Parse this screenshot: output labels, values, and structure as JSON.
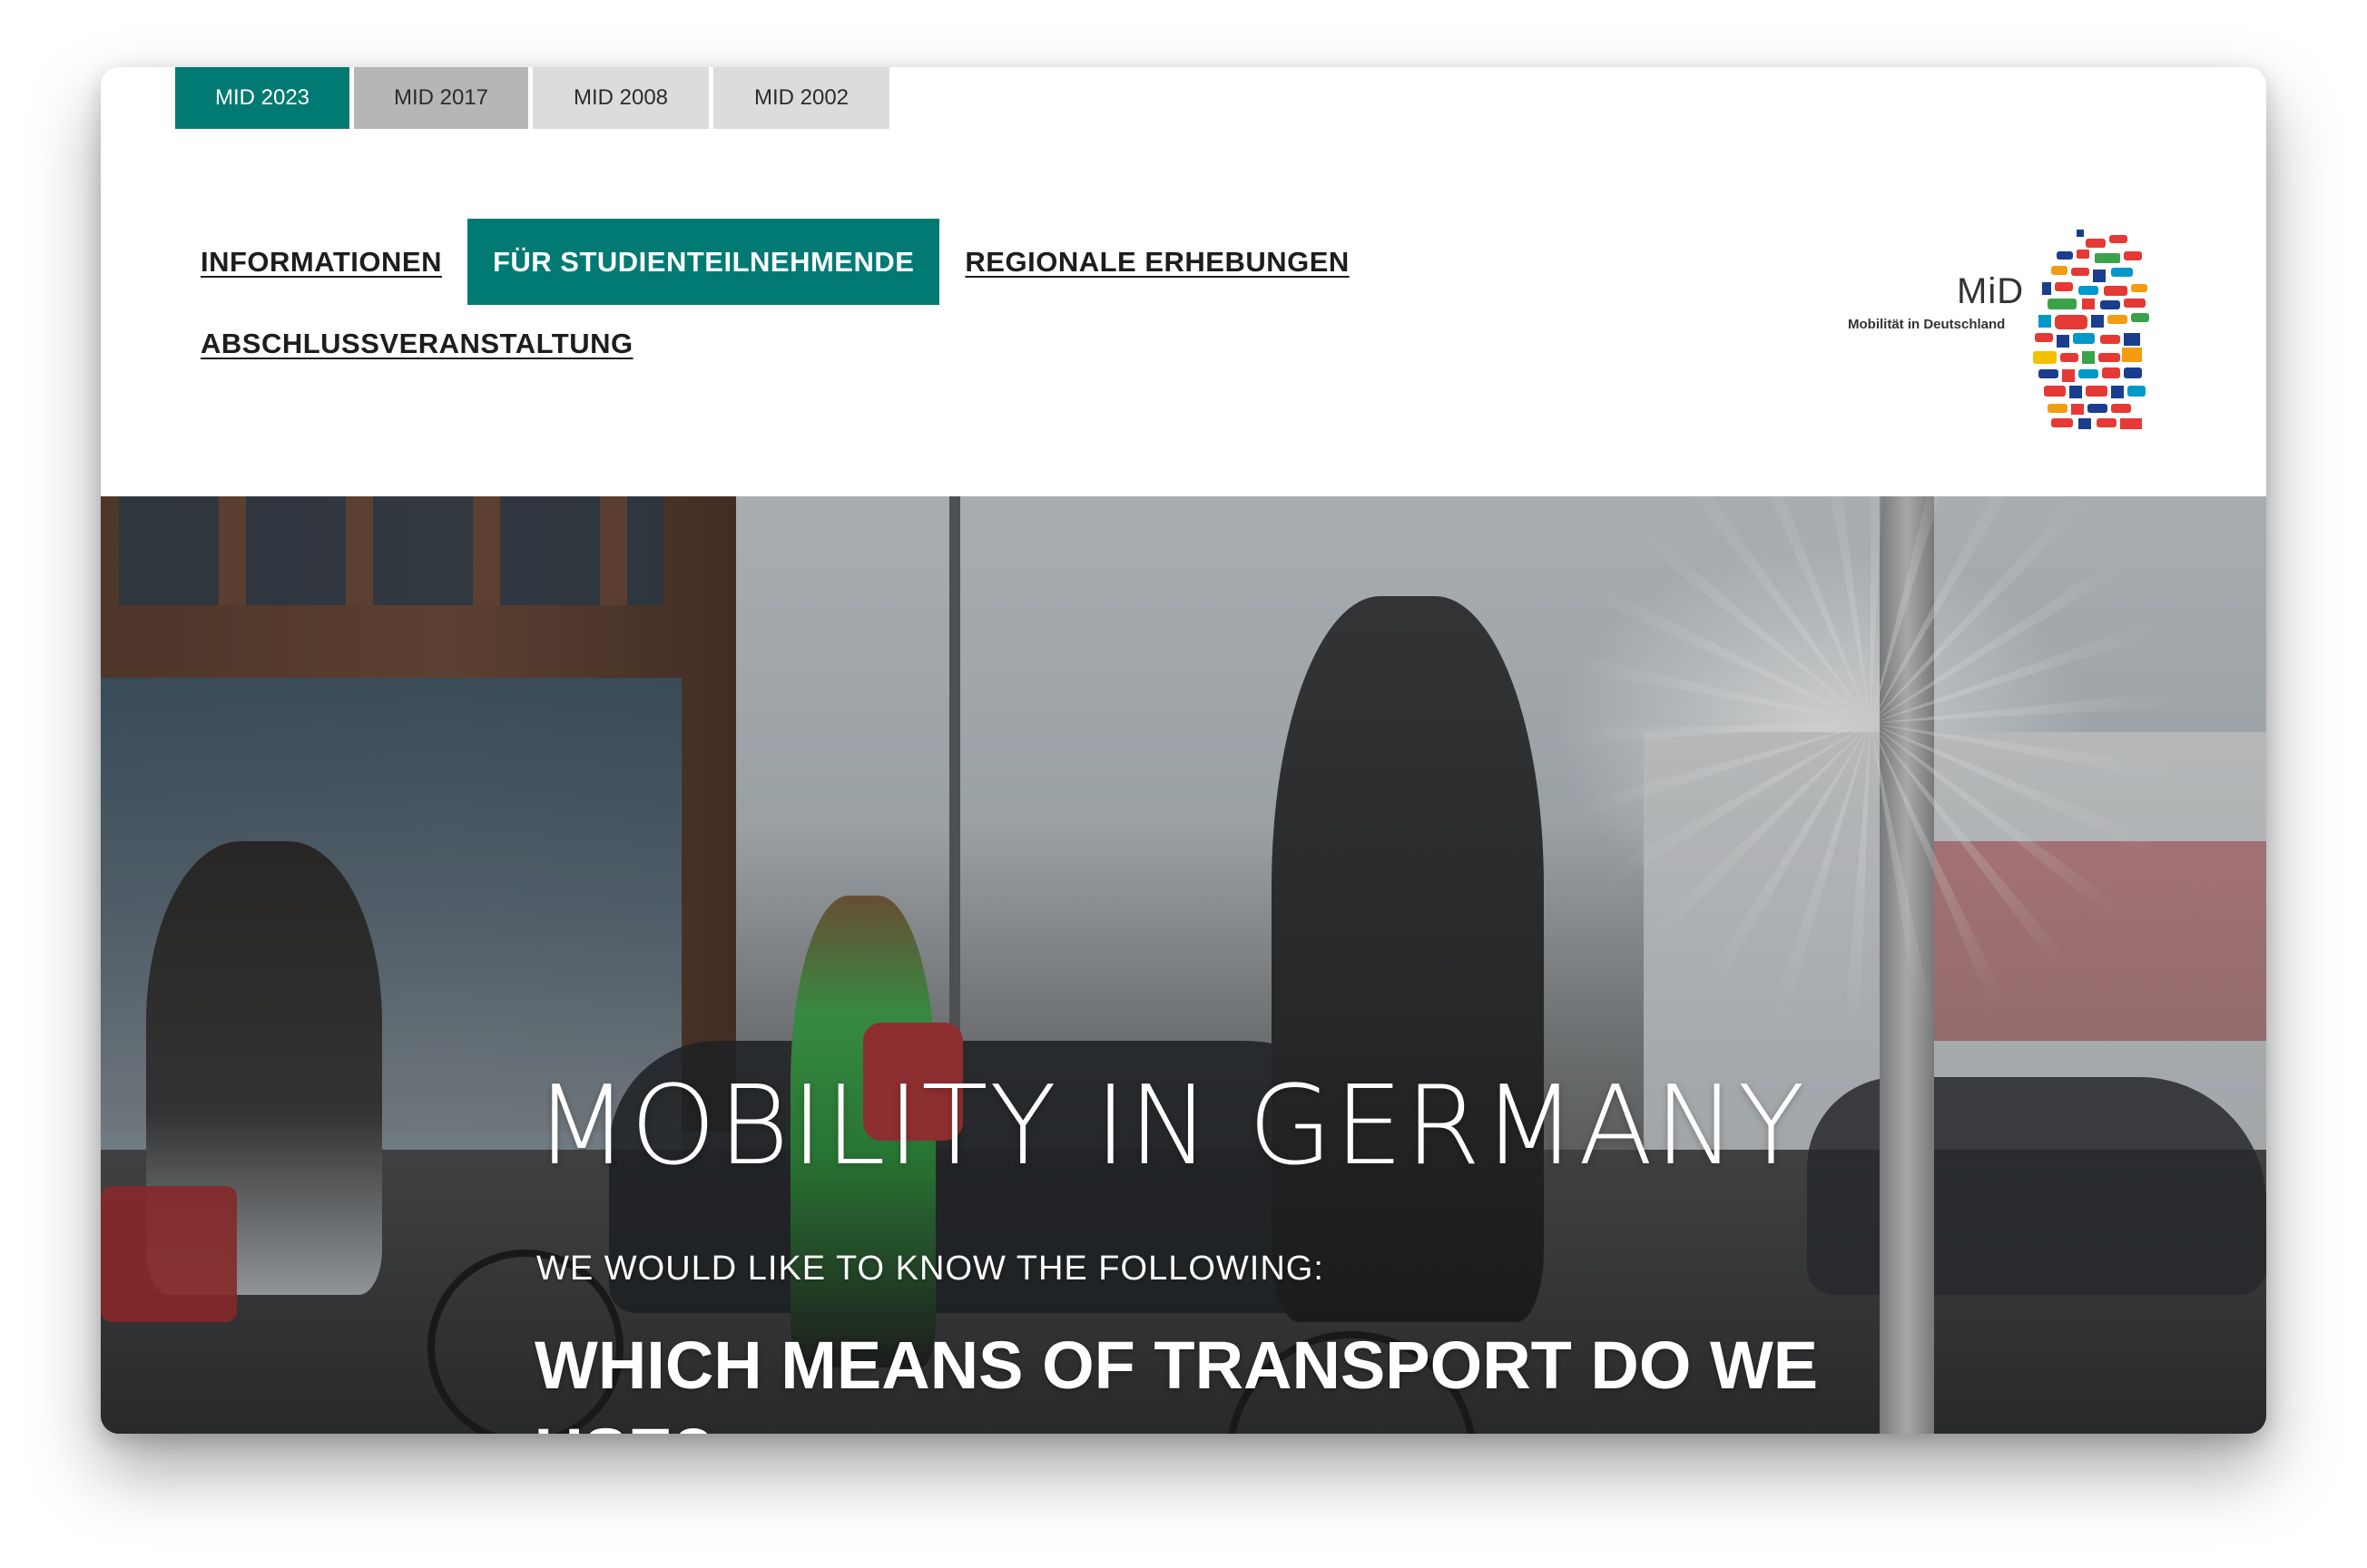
{
  "version_tabs": [
    {
      "label": "MID 2023",
      "state": "active"
    },
    {
      "label": "MID 2017",
      "state": "hover"
    },
    {
      "label": "MID 2008",
      "state": "default"
    },
    {
      "label": "MID 2002",
      "state": "default"
    }
  ],
  "nav": {
    "items": [
      {
        "label": "INFORMATIONEN",
        "active": false
      },
      {
        "label": "FÜR STUDIENTEILNEHMENDE",
        "active": true
      },
      {
        "label": "REGIONALE ERHEBUNGEN",
        "active": false
      },
      {
        "label": "ABSCHLUSSVERANSTALTUNG",
        "active": false
      }
    ]
  },
  "logo": {
    "title": "MiD",
    "subtitle": "Mobilität in Deutschland",
    "icon": "germany-map-transport-icons"
  },
  "hero": {
    "title": "MOBILITY IN GERMANY",
    "subtitle": "WE WOULD LIKE TO KNOW THE FOLLOWING:",
    "question": "WHICH MEANS OF TRANSPORT DO WE USE?",
    "image": "street-scene-cyclists-pedestrians"
  },
  "colors": {
    "accent": "#007a73",
    "tab_hover": "#b5b6b8",
    "tab_default": "#dcdcdc"
  }
}
